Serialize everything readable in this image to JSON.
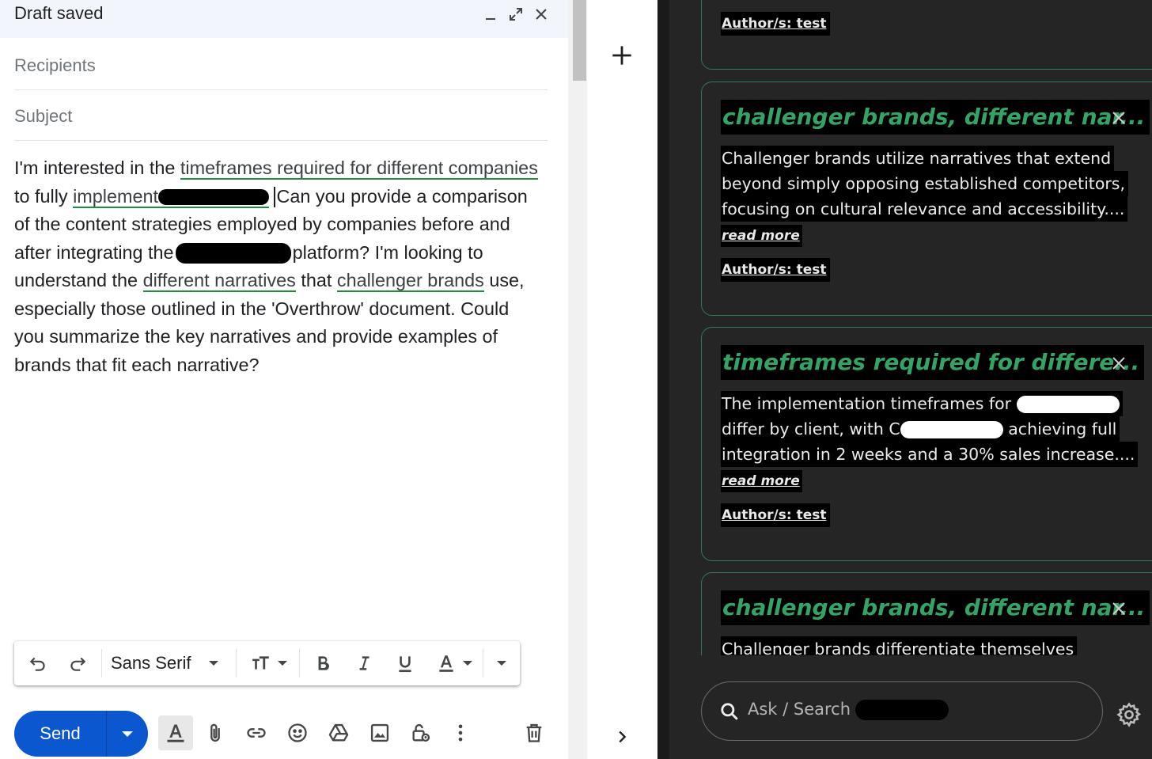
{
  "compose": {
    "title": "Draft saved",
    "recipients_placeholder": "Recipients",
    "subject_placeholder": "Subject",
    "body": {
      "l1a": "I'm interested in the ",
      "l1b": "timeframes required for different companies",
      "l2a": "to fully ",
      "l2b": "implement",
      "l2c": "Can you provide a comparison",
      "l3": "of the content strategies employed by companies before and",
      "l4a": "after integrating the",
      "l4b": "platform? I'm looking to",
      "l5a": "understand the ",
      "l5b": "different narratives",
      "l5c": " that ",
      "l5d": "challenger brands",
      "l5e": " use,",
      "l6": "especially those outlined in the 'Overthrow' document. Could",
      "l7": "you summarize the key narratives and provide examples of",
      "l8": "brands that fit each narrative?"
    },
    "toolbar": {
      "font": "Sans Serif"
    },
    "send_label": "Send"
  },
  "panel": {
    "cards": [
      {
        "author": "Author/s: test"
      },
      {
        "title": "challenger brands, different nar...",
        "lines": [
          "Challenger brands utilize narratives that extend",
          "beyond simply opposing established competitors,",
          "focusing on cultural relevance and accessibility...."
        ],
        "read_more": "read more",
        "author": "Author/s: test"
      },
      {
        "title": "timeframes required for differe...",
        "l1": "The implementation timeframes for",
        "l2a": "differ by client, with C",
        "l2b": "achieving full",
        "l3": "integration in 2 weeks and a 30% sales increase....",
        "read_more": "read more",
        "author": "Author/s: test"
      },
      {
        "title": "challenger brands, different nar...",
        "l1": "Challenger brands differentiate themselves"
      }
    ],
    "search_placeholder": "Ask / Search"
  },
  "colors": {
    "accent_green": "#34a466",
    "send_blue": "#0b57d0",
    "panel_bg": "#252525"
  }
}
